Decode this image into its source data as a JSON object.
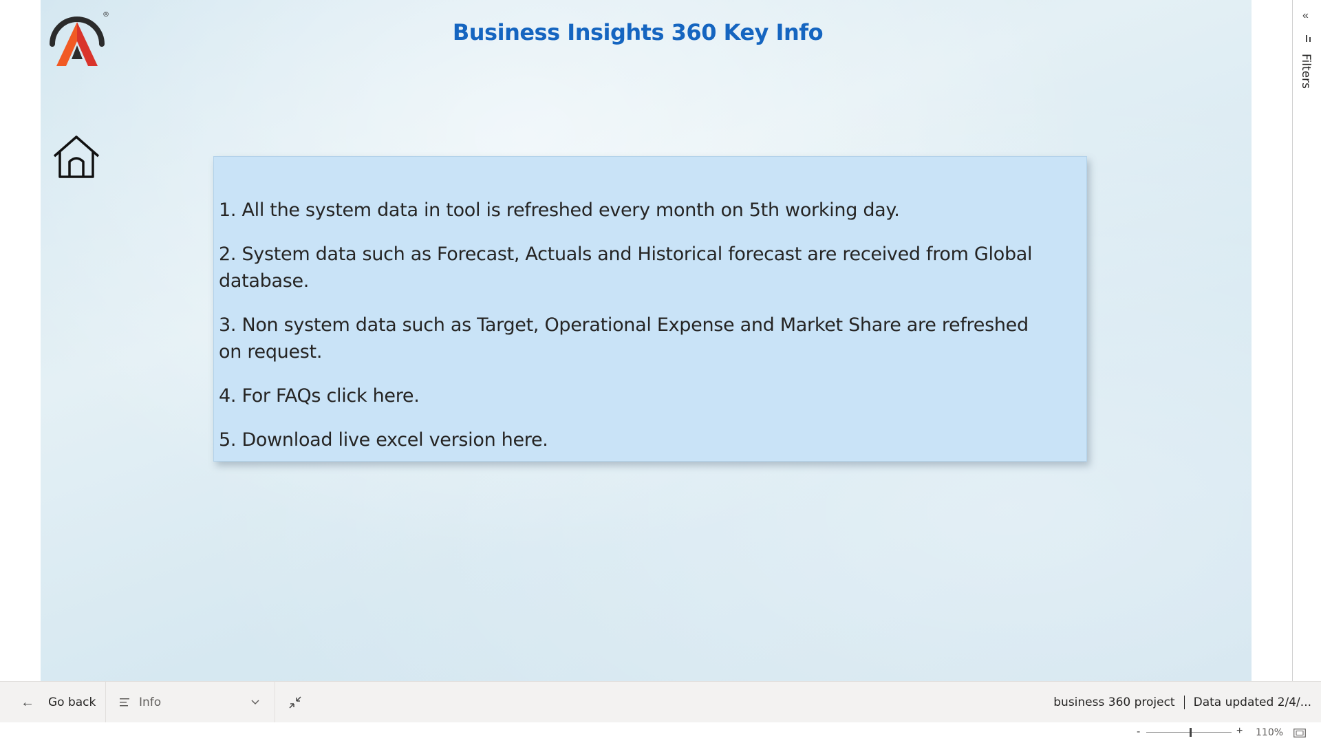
{
  "report": {
    "title": "Business Insights 360 Key Info",
    "info_items": [
      "1. All the system data in tool is refreshed every month on 5th working day.",
      "2.  System data such as Forecast, Actuals and Historical forecast are received from Global database.",
      "3.  Non system data such as Target, Operational Expense and Market Share are refreshed on request.",
      "4. For FAQs click here.",
      "5. Download live excel version here."
    ]
  },
  "icons": {
    "logo": "atliq-logo",
    "home": "home-icon",
    "filters_collapse": "double-chevron-left-icon",
    "filters": "filter-icon",
    "go_back": "arrow-left-icon",
    "page_menu": "list-icon",
    "page_dropdown": "chevron-down-icon",
    "fit": "collapse-arrows-icon",
    "fit_page": "fit-to-page-icon"
  },
  "filters_pane": {
    "label": "Filters"
  },
  "bottom_bar": {
    "go_back_label": "Go back",
    "page_selected": "Info",
    "project_name": "business 360 project",
    "data_updated": "Data updated 2/4/..."
  },
  "zoom": {
    "minus": "-",
    "plus": "+",
    "value": "110%",
    "level_fraction": 0.5
  },
  "colors": {
    "title": "#1565c0",
    "card_background": "#c9e3f7",
    "logo_orange": "#f15a24",
    "logo_red": "#d9342b",
    "logo_dark": "#2b2b2b"
  }
}
